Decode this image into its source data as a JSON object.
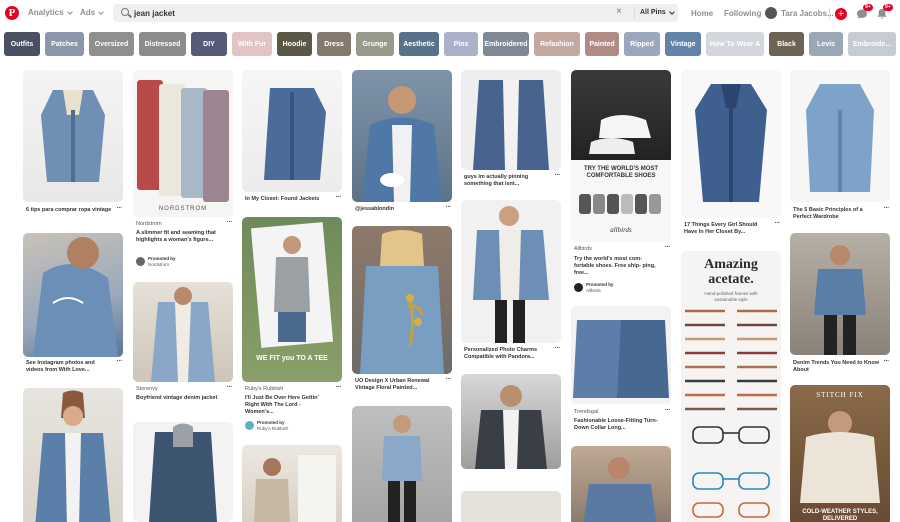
{
  "header": {
    "logo_letter": "P",
    "nav": [
      {
        "label": "Analytics"
      },
      {
        "label": "Ads"
      }
    ],
    "search": {
      "value": "jean jacket",
      "placeholder": "Search",
      "clear_glyph": "×",
      "scope": "All Pins"
    },
    "links": [
      {
        "label": "Home"
      },
      {
        "label": "Following"
      }
    ],
    "user_name": "Tara Jacobs...",
    "plus_glyph": "+",
    "badges": {
      "messages": "9+",
      "notifications": "9+"
    }
  },
  "guides": [
    {
      "label": "Outfits",
      "color": "#4a4f61"
    },
    {
      "label": "Patches",
      "color": "#8a97a8"
    },
    {
      "label": "Oversized",
      "color": "#8f8f8f"
    },
    {
      "label": "Distressed",
      "color": "#8c8c8c"
    },
    {
      "label": "DIY",
      "color": "#545a78"
    },
    {
      "label": "With Fur",
      "color": "#e3c4c6"
    },
    {
      "label": "Hoodie",
      "color": "#5c5847"
    },
    {
      "label": "Dress",
      "color": "#867a6e"
    },
    {
      "label": "Grunge",
      "color": "#9a9a8c"
    },
    {
      "label": "Aesthetic",
      "color": "#57728a"
    },
    {
      "label": "Pins",
      "color": "#aab1c9"
    },
    {
      "label": "Embroidered",
      "color": "#7f8996"
    },
    {
      "label": "Refashion",
      "color": "#c2a89f"
    },
    {
      "label": "Painted",
      "color": "#b08b86"
    },
    {
      "label": "Ripped",
      "color": "#9ba7be"
    },
    {
      "label": "Vintage",
      "color": "#6383a8"
    },
    {
      "label": "How To Wear A",
      "color": "#d3d6dc"
    },
    {
      "label": "Black",
      "color": "#6e6254"
    },
    {
      "label": "Levis",
      "color": "#9aa8b6"
    },
    {
      "label": "Embroide...",
      "color": "#c7ccd4"
    }
  ],
  "more_glyph": "···",
  "pins": {
    "c1p1": {
      "title": "6 tips para comprar ropa vintage"
    },
    "c1p2": {
      "title": "See Instagram photos and videos from With Love..."
    },
    "c2p1": {
      "brand": "NORDSTROM",
      "source": "Nordstrom",
      "title": "A slimmer fit and seaming that highlights a woman's figure...",
      "promoted_label": "Promoted by",
      "promoted_by": "Nordstrom"
    },
    "c2p2": {
      "source": "Storenvy",
      "title": "Boyfriend vintage denim jacket"
    },
    "c3p1": {
      "title": "In My Closet: Found Jackets"
    },
    "c3p2": {
      "overlay": "WE FIT you TO A TEE",
      "source": "Ruby's Rubbish",
      "title": "I'll Just Be Over Here Gettin' Right With The Lord - Women's...",
      "promoted_label": "Promoted by",
      "promoted_by": "Ruby's Rubbish"
    },
    "c4p1": {
      "title": "@jessablondin"
    },
    "c4p2": {
      "title": "UO Design X Urban Renewal Vintage Floral Painted..."
    },
    "c5p1": {
      "title": "guys im actually pinning something that isnt..."
    },
    "c5p2": {
      "title": "Personalized Photo Charms Compatible with Pandora..."
    },
    "c6p1": {
      "ad_heading": "TRY THE WORLD'S MOST COMFORTABLE SHOES",
      "ad_brand": "allbirds",
      "source": "Allbirds",
      "title": "Try the world's most com- fortable shoes. Free ship- ping, free...",
      "promoted_label": "Promoted by",
      "promoted_by": "Allbirds"
    },
    "c6p2": {
      "source": "Trendsgal",
      "title": "Fashionable Loose-Fitting Turn-Down Collar Long..."
    },
    "c7p1": {
      "title": "17 Things Every Girl Should Have In Her Closet By..."
    },
    "c7p2": {
      "ad_heading": "Amazing acetate.",
      "ad_sub": "Hand-polished frames with sustainable style"
    },
    "c8p1": {
      "title": "The 5 Basic Principles of a Perfect Wardrobe"
    },
    "c8p2": {
      "title": "Denim Trends You Need to Know About"
    },
    "c8p3": {
      "brand": "STITCH FIX",
      "caption": "COLD-WEATHER STYLES, DELIVERED"
    }
  }
}
